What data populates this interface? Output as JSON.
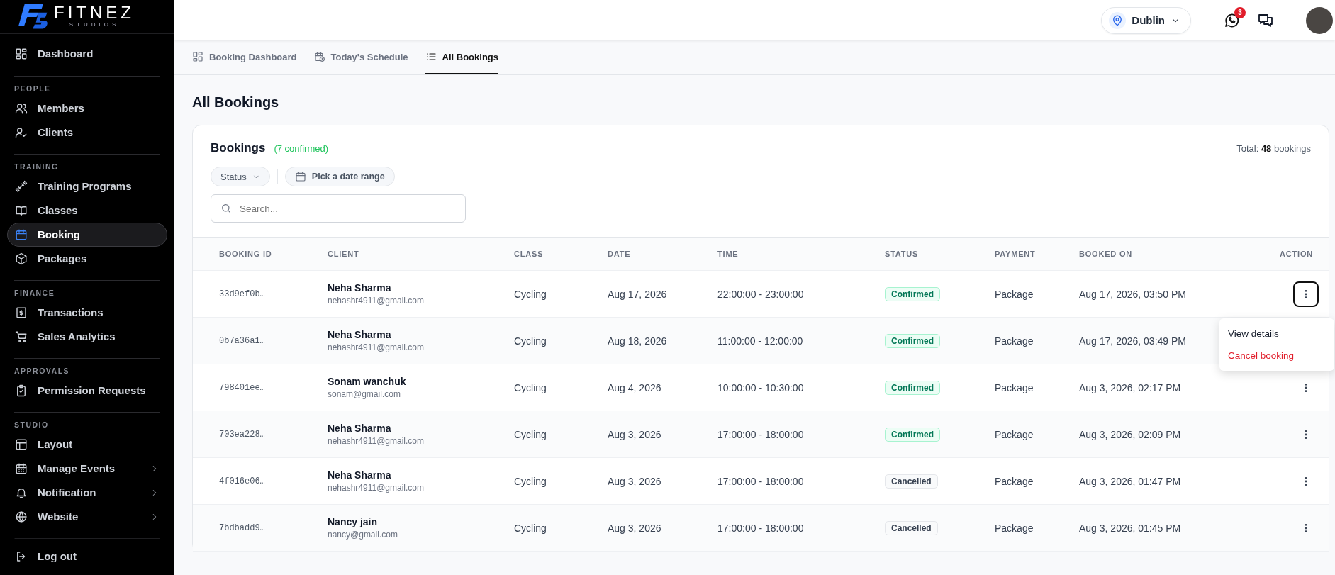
{
  "sidebar": {
    "logo": {
      "brand": "FITNEZ",
      "tagline": "STUDIOS"
    },
    "sections": [
      {
        "items": [
          {
            "label": "Dashboard",
            "selected": false,
            "expandable": false
          }
        ]
      },
      {
        "label": "PEOPLE",
        "items": [
          {
            "label": "Members",
            "selected": false,
            "expandable": false
          },
          {
            "label": "Clients",
            "selected": false,
            "expandable": false
          }
        ]
      },
      {
        "label": "TRAINING",
        "items": [
          {
            "label": "Training Programs",
            "selected": false,
            "expandable": false
          },
          {
            "label": "Classes",
            "selected": false,
            "expandable": false
          },
          {
            "label": "Booking",
            "selected": true,
            "expandable": false
          },
          {
            "label": "Packages",
            "selected": false,
            "expandable": false
          }
        ]
      },
      {
        "label": "FINANCE",
        "items": [
          {
            "label": "Transactions",
            "selected": false,
            "expandable": false
          },
          {
            "label": "Sales Analytics",
            "selected": false,
            "expandable": false
          }
        ]
      },
      {
        "label": "APPROVALS",
        "items": [
          {
            "label": "Permission Requests",
            "selected": false,
            "expandable": false
          }
        ]
      },
      {
        "label": "STUDIO",
        "items": [
          {
            "label": "Layout",
            "selected": false,
            "expandable": false
          },
          {
            "label": "Manage Events",
            "selected": false,
            "expandable": true
          },
          {
            "label": "Notification",
            "selected": false,
            "expandable": true
          },
          {
            "label": "Website",
            "selected": false,
            "expandable": true
          }
        ]
      }
    ],
    "footer_item": {
      "label": "Log out"
    }
  },
  "header": {
    "location": "Dublin",
    "whatsapp_badge": "3"
  },
  "tabs": [
    {
      "label": "Booking Dashboard",
      "selected": false
    },
    {
      "label": "Today's Schedule",
      "selected": false
    },
    {
      "label": "All Bookings",
      "selected": true
    }
  ],
  "page_title": "All Bookings",
  "bookings_card": {
    "title": "Bookings",
    "confirmed_note": "(7 confirmed)",
    "total": "Total: **48** bookings",
    "filters": {
      "status": "Status",
      "date_range": "Pick a date range"
    },
    "search": {
      "placeholder": "Search..."
    },
    "table": {
      "columns": [
        "BOOKING ID",
        "CLIENT",
        "CLASS",
        "DATE",
        "TIME",
        "STATUS",
        "PAYMENT",
        "BOOKED ON",
        "ACTION"
      ],
      "rows": [
        {
          "booking_id": "33d9ef0b…",
          "client_name": "Neha Sharma",
          "client_email": "nehashr4911@gmail.com",
          "class": "Cycling",
          "date": "Aug 17, 2026",
          "time": "22:00:00 - 23:00:00",
          "status": {
            "label": "Confirmed",
            "kind": "confirmed"
          },
          "payment": "Package",
          "booked_on": "Aug 17, 2026, 03:50 PM",
          "menu_open": true
        },
        {
          "booking_id": "0b7a36a1…",
          "client_name": "Neha Sharma",
          "client_email": "nehashr4911@gmail.com",
          "class": "Cycling",
          "date": "Aug 18, 2026",
          "time": "11:00:00 - 12:00:00",
          "status": {
            "label": "Confirmed",
            "kind": "confirmed"
          },
          "payment": "Package",
          "booked_on": "Aug 17, 2026, 03:49 PM",
          "menu_open": false
        },
        {
          "booking_id": "798401ee…",
          "client_name": "Sonam wanchuk",
          "client_email": "sonam@gmail.com",
          "class": "Cycling",
          "date": "Aug 4, 2026",
          "time": "10:00:00 - 10:30:00",
          "status": {
            "label": "Confirmed",
            "kind": "confirmed"
          },
          "payment": "Package",
          "booked_on": "Aug 3, 2026, 02:17 PM",
          "menu_open": false
        },
        {
          "booking_id": "703ea228…",
          "client_name": "Neha Sharma",
          "client_email": "nehashr4911@gmail.com",
          "class": "Cycling",
          "date": "Aug 3, 2026",
          "time": "17:00:00 - 18:00:00",
          "status": {
            "label": "Confirmed",
            "kind": "confirmed"
          },
          "payment": "Package",
          "booked_on": "Aug 3, 2026, 02:09 PM",
          "menu_open": false
        },
        {
          "booking_id": "4f016e06…",
          "client_name": "Neha Sharma",
          "client_email": "nehashr4911@gmail.com",
          "class": "Cycling",
          "date": "Aug 3, 2026",
          "time": "17:00:00 - 18:00:00",
          "status": {
            "label": "Cancelled",
            "kind": "cancelled"
          },
          "payment": "Package",
          "booked_on": "Aug 3, 2026, 01:47 PM",
          "menu_open": false
        },
        {
          "booking_id": "7bdbadd9…",
          "client_name": "Nancy jain",
          "client_email": "nancy@gmail.com",
          "class": "Cycling",
          "date": "Aug 3, 2026",
          "time": "17:00:00 - 18:00:00",
          "status": {
            "label": "Cancelled",
            "kind": "cancelled"
          },
          "payment": "Package",
          "booked_on": "Aug 3, 2026, 01:45 PM",
          "menu_open": false
        }
      ],
      "action_menu": [
        {
          "label": "View details",
          "kind": "normal"
        },
        {
          "label": "Cancel booking",
          "kind": "danger"
        }
      ]
    }
  }
}
